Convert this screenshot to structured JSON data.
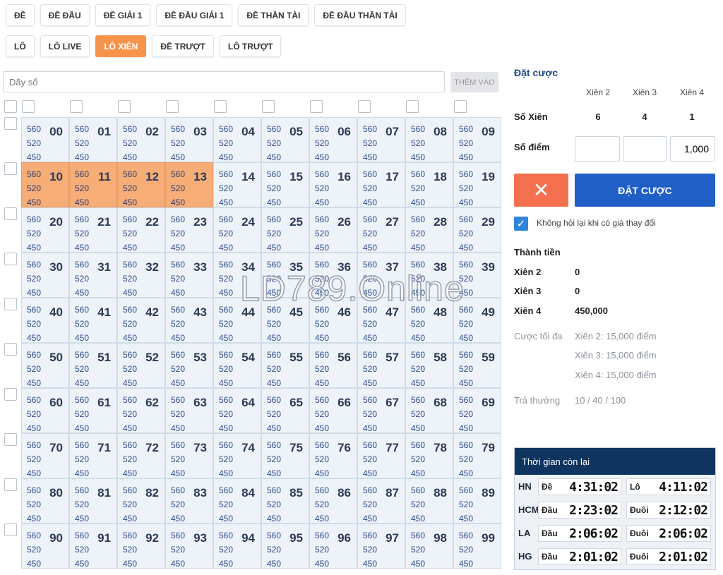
{
  "tabs_row1": [
    "ĐỀ",
    "ĐỀ ĐẦU",
    "ĐỀ GIẢI 1",
    "ĐỀ ĐẦU GIẢI 1",
    "ĐỀ THẦN TÀI",
    "ĐỀ ĐẦU THẦN TÀI"
  ],
  "tabs_row2": [
    "LÔ",
    "LÔ LIVE",
    "LÔ XIÊN",
    "ĐỀ TRƯỢT",
    "LÔ TRƯỢT"
  ],
  "active_tab": "LÔ XIÊN",
  "accent_color": "#f7944b",
  "input": {
    "placeholder": "Dãy số",
    "value": "",
    "add_label": "THÊM VÀO"
  },
  "odds": [
    "560",
    "520",
    "450"
  ],
  "numbers": [
    "00",
    "01",
    "02",
    "03",
    "04",
    "05",
    "06",
    "07",
    "08",
    "09",
    "10",
    "11",
    "12",
    "13",
    "14",
    "15",
    "16",
    "17",
    "18",
    "19",
    "20",
    "21",
    "22",
    "23",
    "24",
    "25",
    "26",
    "27",
    "28",
    "29",
    "30",
    "31",
    "32",
    "33",
    "34",
    "35",
    "36",
    "37",
    "38",
    "39",
    "40",
    "41",
    "42",
    "43",
    "44",
    "45",
    "46",
    "47",
    "48",
    "49",
    "50",
    "51",
    "52",
    "53",
    "54",
    "55",
    "56",
    "57",
    "58",
    "59",
    "60",
    "61",
    "62",
    "63",
    "64",
    "65",
    "66",
    "67",
    "68",
    "69",
    "70",
    "71",
    "72",
    "73",
    "74",
    "75",
    "76",
    "77",
    "78",
    "79",
    "80",
    "81",
    "82",
    "83",
    "84",
    "85",
    "86",
    "87",
    "88",
    "89",
    "90",
    "91",
    "92",
    "93",
    "94",
    "95",
    "96",
    "97",
    "98",
    "99"
  ],
  "selected": [
    "10",
    "11",
    "12",
    "13"
  ],
  "watermark": "LD789.Online",
  "bet": {
    "title": "Đặt cược",
    "headers": [
      "Xiên 2",
      "Xiên 3",
      "Xiên 4"
    ],
    "so_xien_label": "Số Xiên",
    "so_xien": [
      "6",
      "4",
      "1"
    ],
    "so_diem_label": "Số điểm",
    "points": [
      "",
      "",
      "1,000"
    ],
    "cancel_icon": "close-icon",
    "submit_label": "ĐẶT CƯỢC",
    "confirm_label": "Không hỏi lại khi có giá thay đổi",
    "confirm_checked": true
  },
  "totals": {
    "title": "Thành tiền",
    "rows": [
      {
        "label": "Xiên 2",
        "value": "0"
      },
      {
        "label": "Xiên 3",
        "value": "0"
      },
      {
        "label": "Xiên 4",
        "value": "450,000"
      }
    ],
    "max_label": "Cược tối đa",
    "max": [
      "Xiên 2: 15,000 điểm",
      "Xiên 3: 15,000 điểm",
      "Xiên 4: 15,000 điểm"
    ],
    "payout_label": "Trả thưởng",
    "payout": "10 / 40 / 100"
  },
  "timer": {
    "title": "Thời gian còn lại",
    "rows": [
      {
        "region": "HN",
        "a_label": "Đề",
        "a_time": "4:31:02",
        "b_label": "Lô",
        "b_time": "4:11:02"
      },
      {
        "region": "HCM",
        "a_label": "Đầu",
        "a_time": "2:23:02",
        "b_label": "Đuôi",
        "b_time": "2:12:02"
      },
      {
        "region": "LA",
        "a_label": "Đầu",
        "a_time": "2:06:02",
        "b_label": "Đuôi",
        "b_time": "2:06:02"
      },
      {
        "region": "HG",
        "a_label": "Đầu",
        "a_time": "2:01:02",
        "b_label": "Đuôi",
        "b_time": "2:01:02"
      }
    ]
  }
}
